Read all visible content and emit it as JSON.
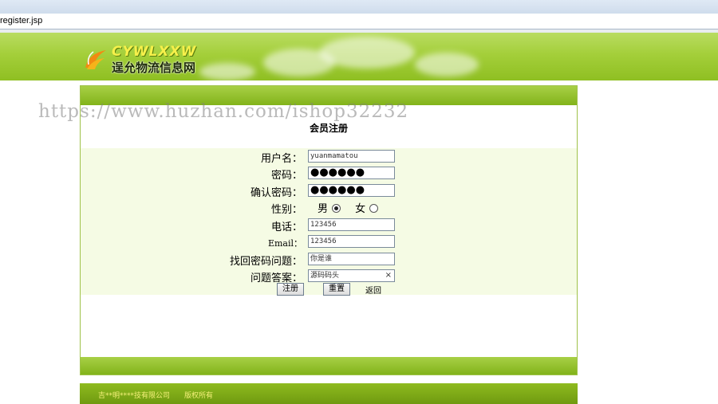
{
  "browser": {
    "address": "register.jsp"
  },
  "site": {
    "logo_en": "CYWLXXW",
    "logo_cn": "逞允物流信息网"
  },
  "watermark": "https://www.huzhan.com/ishop32232",
  "form": {
    "title": "会员注册",
    "username": {
      "label": "用户名：",
      "value": "yuanmamatou"
    },
    "password": {
      "label": "密码：",
      "value": "●●●●●●"
    },
    "confirm_password": {
      "label": "确认密码：",
      "value": "●●●●●●"
    },
    "gender": {
      "label": "性别：",
      "male": "男",
      "female": "女",
      "selected": "男"
    },
    "phone": {
      "label": "电话：",
      "value": "123456"
    },
    "email": {
      "label": "Email：",
      "value": "123456"
    },
    "security_question": {
      "label": "找回密码问题：",
      "value": "你是谁"
    },
    "security_answer": {
      "label": "问题答案：",
      "value": "源码码头",
      "clear_icon": "×"
    },
    "buttons": {
      "register": "注册",
      "reset": "重置",
      "back": "返回"
    }
  },
  "footer": {
    "company": "吉**明****技有限公司",
    "copyright": "版权所有"
  },
  "colors": {
    "header_green": "#a4cf3a",
    "panel_bar_green": "#8fbf22",
    "form_bg": "#f5fbe4",
    "footer_text": "#f4f07a"
  }
}
